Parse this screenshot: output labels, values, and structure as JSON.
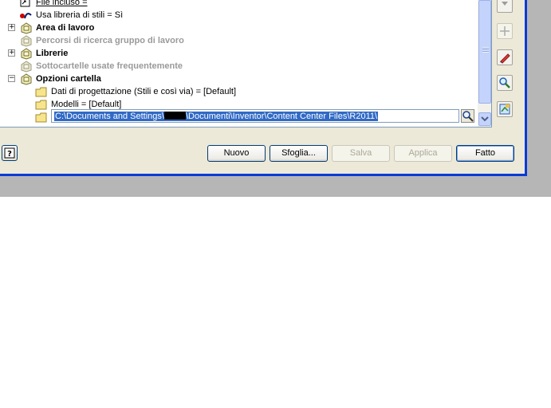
{
  "tree": {
    "rows": [
      {
        "label": "File incluso =",
        "style": "under",
        "icon": "include-file-icon",
        "expander": ""
      },
      {
        "label": "Usa libreria di stili = Sì",
        "style": "normal",
        "icon": "style-library-icon",
        "expander": ""
      },
      {
        "label": "Area di lavoro",
        "style": "bold",
        "icon": "folder-group-icon",
        "expander": "+"
      },
      {
        "label": "Percorsi di ricerca gruppo di lavoro",
        "style": "gray",
        "icon": "folder-group-icon",
        "expander": ""
      },
      {
        "label": "Librerie",
        "style": "bold",
        "icon": "folder-group-icon",
        "expander": "+"
      },
      {
        "label": "Sottocartelle usate frequentemente",
        "style": "gray",
        "icon": "folder-group-icon",
        "expander": ""
      },
      {
        "label": "Opzioni cartella",
        "style": "bold",
        "icon": "folder-group-icon",
        "expander": "−"
      },
      {
        "label": "Dati di progettazione (Stili e così via) = [Default]",
        "style": "normal",
        "icon": "folder-icon",
        "expander": ""
      },
      {
        "label": "Modelli = [Default]",
        "style": "normal",
        "icon": "folder-icon",
        "expander": ""
      }
    ],
    "edit_value_prefix": "C:\\Documents and Settings\\",
    "edit_value_suffix": "\\Documenti\\Inventor\\Content Center Files\\R2011\\"
  },
  "buttons": {
    "nuovo": "Nuovo",
    "sfoglia": "Sfoglia...",
    "salva": "Salva",
    "applica": "Applica",
    "fatto": "Fatto"
  },
  "side_icons": [
    "scroll-down-icon",
    "add-icon",
    "edit-pencil-icon",
    "search-magnifier-icon",
    "options-icon"
  ]
}
